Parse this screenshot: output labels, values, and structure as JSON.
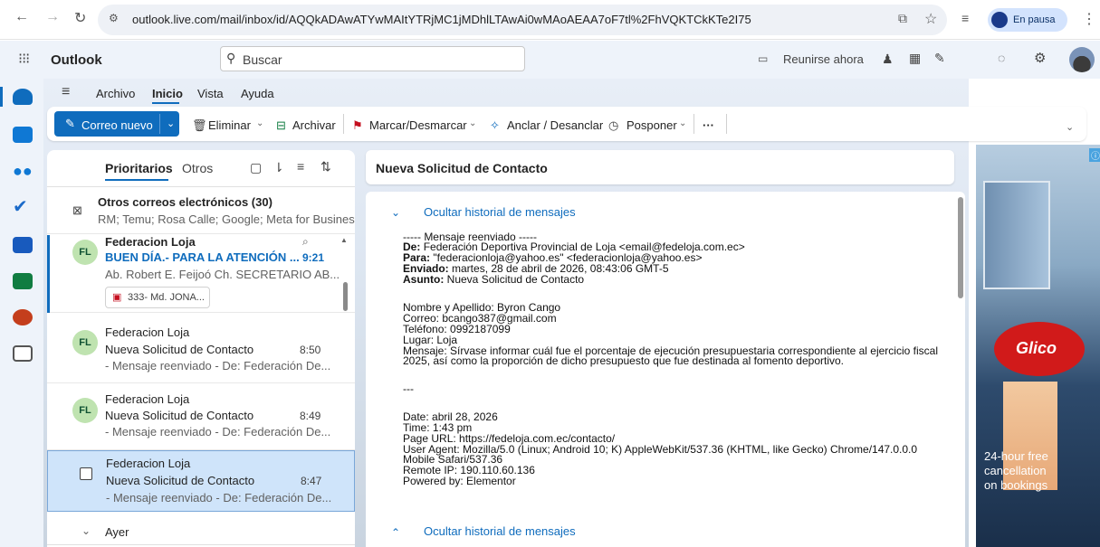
{
  "browser": {
    "url": "outlook.live.com/mail/inbox/id/AQQkADAwATYwMAItYTRjMC1jMDhlLTAwAi0wMAoAEAA7oF7tl%2FhVQKTCkKTe2I75",
    "profile_label": "En pausa"
  },
  "app": {
    "name": "Outlook",
    "search_placeholder": "Buscar",
    "meet_now": "Reunirse ahora"
  },
  "tabs": [
    "Archivo",
    "Inicio",
    "Vista",
    "Ayuda"
  ],
  "ribbon": {
    "new_mail": "Correo nuevo",
    "delete": "Eliminar",
    "archive": "Archivar",
    "flag": "Marcar/Desmarcar",
    "pin": "Anclar / Desanclar",
    "snooze": "Posponer",
    "more": "···"
  },
  "list": {
    "focused": "Prioritarios",
    "other": "Otros",
    "other_mail_title": "Otros correos electrónicos (30)",
    "other_mail_preview": "RM; Temu; Rosa Calle; Google; Meta for Busines...",
    "section_yesterday": "Ayer",
    "items": [
      {
        "initials": "FL",
        "sender": "Federacion Loja",
        "subject": "BUEN DÍA.- PARA LA ATENCIÓN ...",
        "time": "9:21",
        "preview": "Ab. Robert E. Feijoó Ch. SECRETARIO AB...",
        "attachment": "333- Md. JONA..."
      },
      {
        "initials": "FL",
        "sender": "Federacion Loja",
        "subject": "Nueva Solicitud de Contacto",
        "time": "8:50",
        "preview": "- Mensaje reenviado - De: Federación De..."
      },
      {
        "initials": "FL",
        "sender": "Federacion Loja",
        "subject": "Nueva Solicitud de Contacto",
        "time": "8:49",
        "preview": "- Mensaje reenviado - De: Federación De..."
      },
      {
        "initials": "",
        "sender": "Federacion Loja",
        "subject": "Nueva Solicitud de Contacto",
        "time": "8:47",
        "preview": "- Mensaje reenviado - De: Federación De..."
      }
    ]
  },
  "reading": {
    "subject": "Nueva Solicitud de Contacto",
    "hide_history": "Ocultar historial de mensajes",
    "fw_header": "----- Mensaje reenviado -----",
    "de_label": "De:",
    "de_value": "Federación Deportiva Provincial de Loja <email@fedeloja.com.ec>",
    "para_label": "Para:",
    "para_value": "\"federacionloja@yahoo.es\" <federacionloja@yahoo.es>",
    "enviado_label": "Enviado:",
    "enviado_value": "martes, 28 de abril de 2026, 08:43:06 GMT-5",
    "asunto_label": "Asunto:",
    "asunto_value": "Nueva Solicitud de Contacto",
    "body_lines": [
      "Nombre y Apellido: Byron Cango",
      "Correo: bcango387@gmail.com",
      "Teléfono: 0992187099",
      "Lugar: Loja",
      "Mensaje: Sírvase informar cuál fue el porcentaje de ejecución presupuestaria correspondiente al ejercicio fiscal",
      "2025, así como la proporción de dicho presupuesto que fue destinada al fomento deportivo."
    ],
    "separator": "---",
    "meta_lines": [
      "Date: abril 28, 2026",
      "Time: 1:43 pm",
      "Page URL: https://fedeloja.com.ec/contacto/",
      "User Agent: Mozilla/5.0 (Linux; Android 10; K) AppleWebKit/537.36 (KHTML, like Gecko) Chrome/147.0.0.0",
      "Mobile Safari/537.36",
      "Remote IP: 190.110.60.136",
      "Powered by: Elementor"
    ]
  },
  "ad": {
    "brand": "Glico",
    "text_1": "24-hour free",
    "text_2": "cancellation",
    "text_3": "on bookings"
  },
  "colors": {
    "accent": "#0f6cbd",
    "selected": "#cfe4fa",
    "avatar_bg": "#bfe3b0"
  }
}
